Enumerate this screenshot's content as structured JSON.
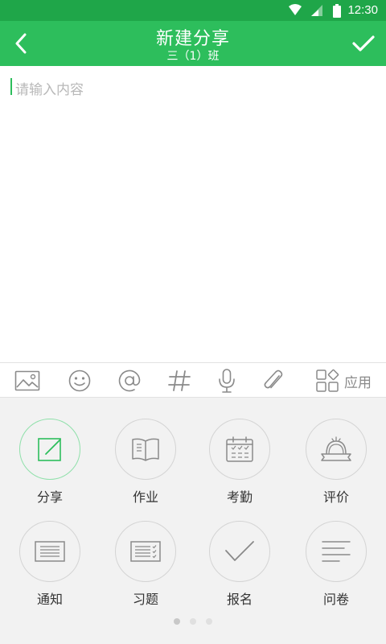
{
  "status_bar": {
    "time": "12:30",
    "wifi_icon": "wifi-icon",
    "signal_icon": "signal-icon",
    "battery_icon": "battery-icon"
  },
  "header": {
    "title": "新建分享",
    "subtitle": "三（1）班",
    "back_icon": "chevron-left-icon",
    "confirm_icon": "check-icon",
    "color": "#2dbe5c"
  },
  "editor": {
    "placeholder": "请输入内容",
    "value": ""
  },
  "toolbar": {
    "tools": [
      "image-icon",
      "emoji-icon",
      "at-icon",
      "hashtag-icon",
      "microphone-icon",
      "attachment-icon"
    ],
    "apps_label": "应用",
    "apps_icon": "apps-grid-icon"
  },
  "panel": {
    "items": [
      {
        "label": "分享",
        "icon": "share-edit-icon",
        "selected": true
      },
      {
        "label": "作业",
        "icon": "book-icon"
      },
      {
        "label": "考勤",
        "icon": "calendar-icon"
      },
      {
        "label": "评价",
        "icon": "award-icon"
      },
      {
        "label": "通知",
        "icon": "notice-icon"
      },
      {
        "label": "习题",
        "icon": "exercise-icon"
      },
      {
        "label": "报名",
        "icon": "check-icon"
      },
      {
        "label": "问卷",
        "icon": "survey-icon"
      }
    ],
    "page_count": 3,
    "current_page": 1,
    "accent": "#2dbe5c"
  }
}
